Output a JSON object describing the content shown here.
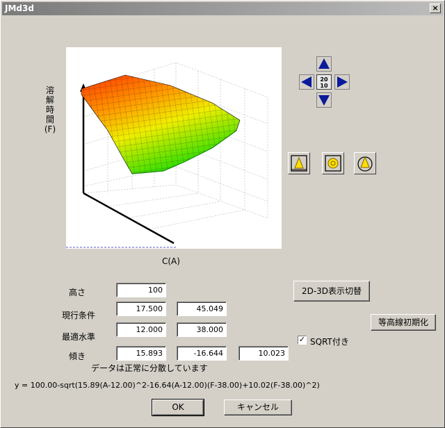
{
  "window": {
    "title": "JMd3d",
    "close": "×"
  },
  "plot": {
    "z_label": "溶\n解\n時\n間\n(F)",
    "x_label": "C(A)"
  },
  "fields": {
    "height": {
      "label": "高さ",
      "value": "100"
    },
    "current": {
      "label": "現行条件",
      "value1": "17.500",
      "value2": "45.049"
    },
    "optimal": {
      "label": "最適水準",
      "value1": "12.000",
      "value2": "38.000"
    },
    "slope": {
      "label": "傾き",
      "value1": "15.893",
      "value2": "-16.644",
      "value3": "10.023"
    }
  },
  "status": "データは正常に分散しています",
  "formula": "y = 100.00-sqrt(15.89(A-12.00)^2-16.64(A-12.00)(F-38.00)+10.02(F-38.00)^2)",
  "buttons": {
    "toggle_2d3d": "2D-3D表示切替",
    "contour_reset": "等高線初期化",
    "ok": "OK",
    "cancel": "キャンセル"
  },
  "sqrt_option": {
    "label": "SQRT付き",
    "checked": true,
    "mark": "✓"
  },
  "colors": {
    "surface_high": "#ff3300",
    "surface_mid": "#ffee00",
    "surface_low": "#22dd00",
    "nav_arrow": "#0a1a9a",
    "view_icon_fill": "#ffe000"
  },
  "icons": [
    "arrow-up-icon",
    "arrow-down-icon",
    "arrow-left-icon",
    "arrow-right-icon",
    "zero-reset-icon",
    "front-view-icon",
    "top-view-icon",
    "rotate-view-icon"
  ]
}
